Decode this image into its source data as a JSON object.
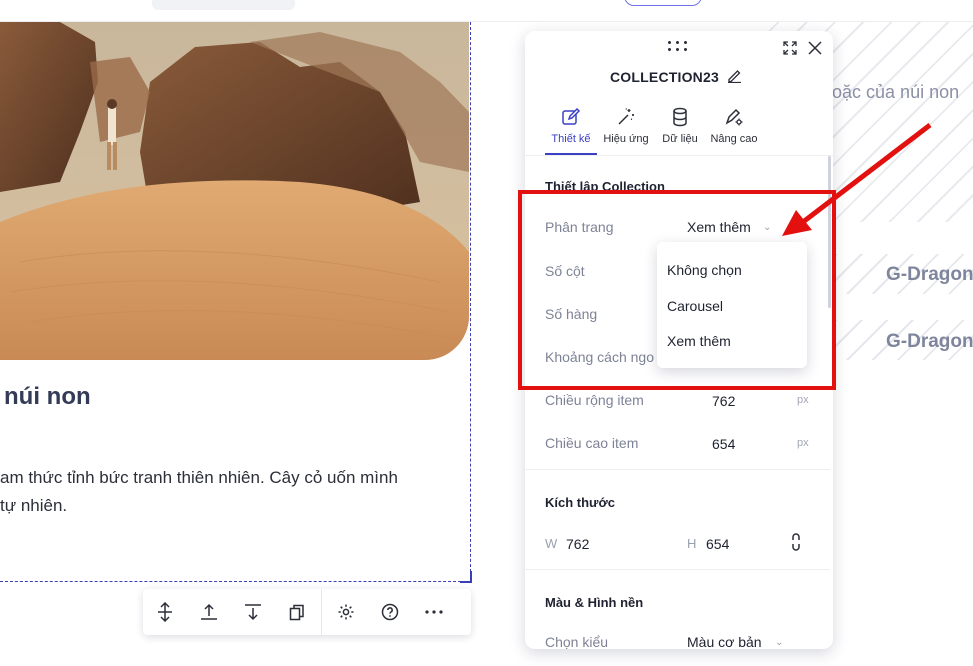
{
  "canvas": {
    "card_title": "núi non",
    "card_desc_line1": "am thức tỉnh bức tranh thiên nhiên. Cây cỏ uốn mình",
    "card_desc_line2": "tự nhiên."
  },
  "background": {
    "teaser_text": "hoặc của núi non",
    "gd_1": "G-Dragon",
    "gd_2": "G-Dragon"
  },
  "toolbar": {
    "icons": [
      "align-vertical-icon",
      "move-up-icon",
      "move-down-icon",
      "duplicate-icon",
      "settings-icon",
      "help-icon",
      "more-icon"
    ]
  },
  "panel": {
    "title": "COLLECTION23",
    "tabs": [
      {
        "label": "Thiết kế",
        "active": true
      },
      {
        "label": "Hiệu ứng",
        "active": false
      },
      {
        "label": "Dữ liệu",
        "active": false
      },
      {
        "label": "Nâng cao",
        "active": false
      }
    ],
    "section_setup": "Thiết lập Collection",
    "pagination_label": "Phân trang",
    "pagination_value": "Xem thêm",
    "columns_label": "Số cột",
    "rows_label": "Số hàng",
    "spacing_label": "Khoảng cách ngo",
    "item_width_label": "Chiều rộng item",
    "item_width_value": "762",
    "item_height_label": "Chiều cao item",
    "item_height_value": "654",
    "unit": "px",
    "section_size": "Kích thước",
    "w_label": "W",
    "w_value": "762",
    "h_label": "H",
    "h_value": "654",
    "section_color": "Màu & Hình nền",
    "style_label": "Chọn kiểu",
    "style_value": "Màu cơ bản"
  },
  "dropdown": {
    "options": [
      "Không chọn",
      "Carousel",
      "Xem thêm"
    ]
  },
  "colors": {
    "accent": "#3a3fc4",
    "annotation": "#e31010"
  }
}
